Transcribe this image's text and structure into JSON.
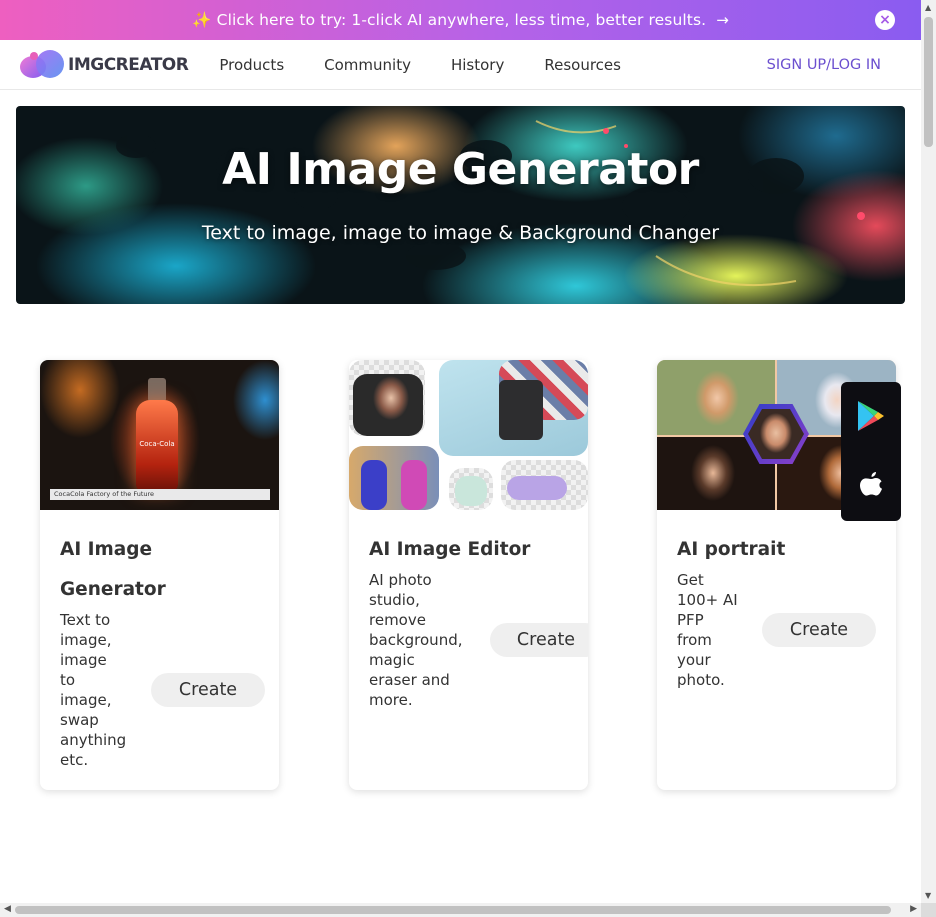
{
  "promo": {
    "text": "✨ Click here to try: 1-click AI anywhere, less time, better results.",
    "arrow": "→",
    "close_icon": "×"
  },
  "nav": {
    "logo_text": "IMGCREATOR",
    "links": [
      "Products",
      "Community",
      "History",
      "Resources"
    ],
    "signin": "SIGN UP/LOG IN"
  },
  "hero": {
    "title": "AI Image Generator",
    "subtitle": "Text to image, image to image & Background Changer"
  },
  "cards": [
    {
      "title_line1": "AI Image",
      "title_line2": "Generator",
      "description": [
        "Text to",
        "image,",
        "image",
        "to",
        "image,",
        "swap",
        "anything",
        "etc."
      ],
      "button": "Create",
      "image_caption": "CocaCola Factory of the Future",
      "bottle_label": "Coca-Cola"
    },
    {
      "title": "AI Image Editor",
      "description": [
        "AI photo",
        "studio,",
        "remove",
        "background,",
        "magic",
        "eraser and",
        "more."
      ],
      "button": "Create"
    },
    {
      "title": "AI portrait",
      "description": [
        "Get",
        "100+ AI",
        "PFP",
        "from",
        "your",
        "photo."
      ],
      "button": "Create"
    }
  ],
  "apps": {
    "icons": [
      "google-play-icon",
      "apple-icon"
    ]
  },
  "colors": {
    "accent": "#6b4fcf",
    "promo_start": "#ee5fc0",
    "promo_end": "#8a5cf0",
    "button_bg": "#efefef"
  }
}
